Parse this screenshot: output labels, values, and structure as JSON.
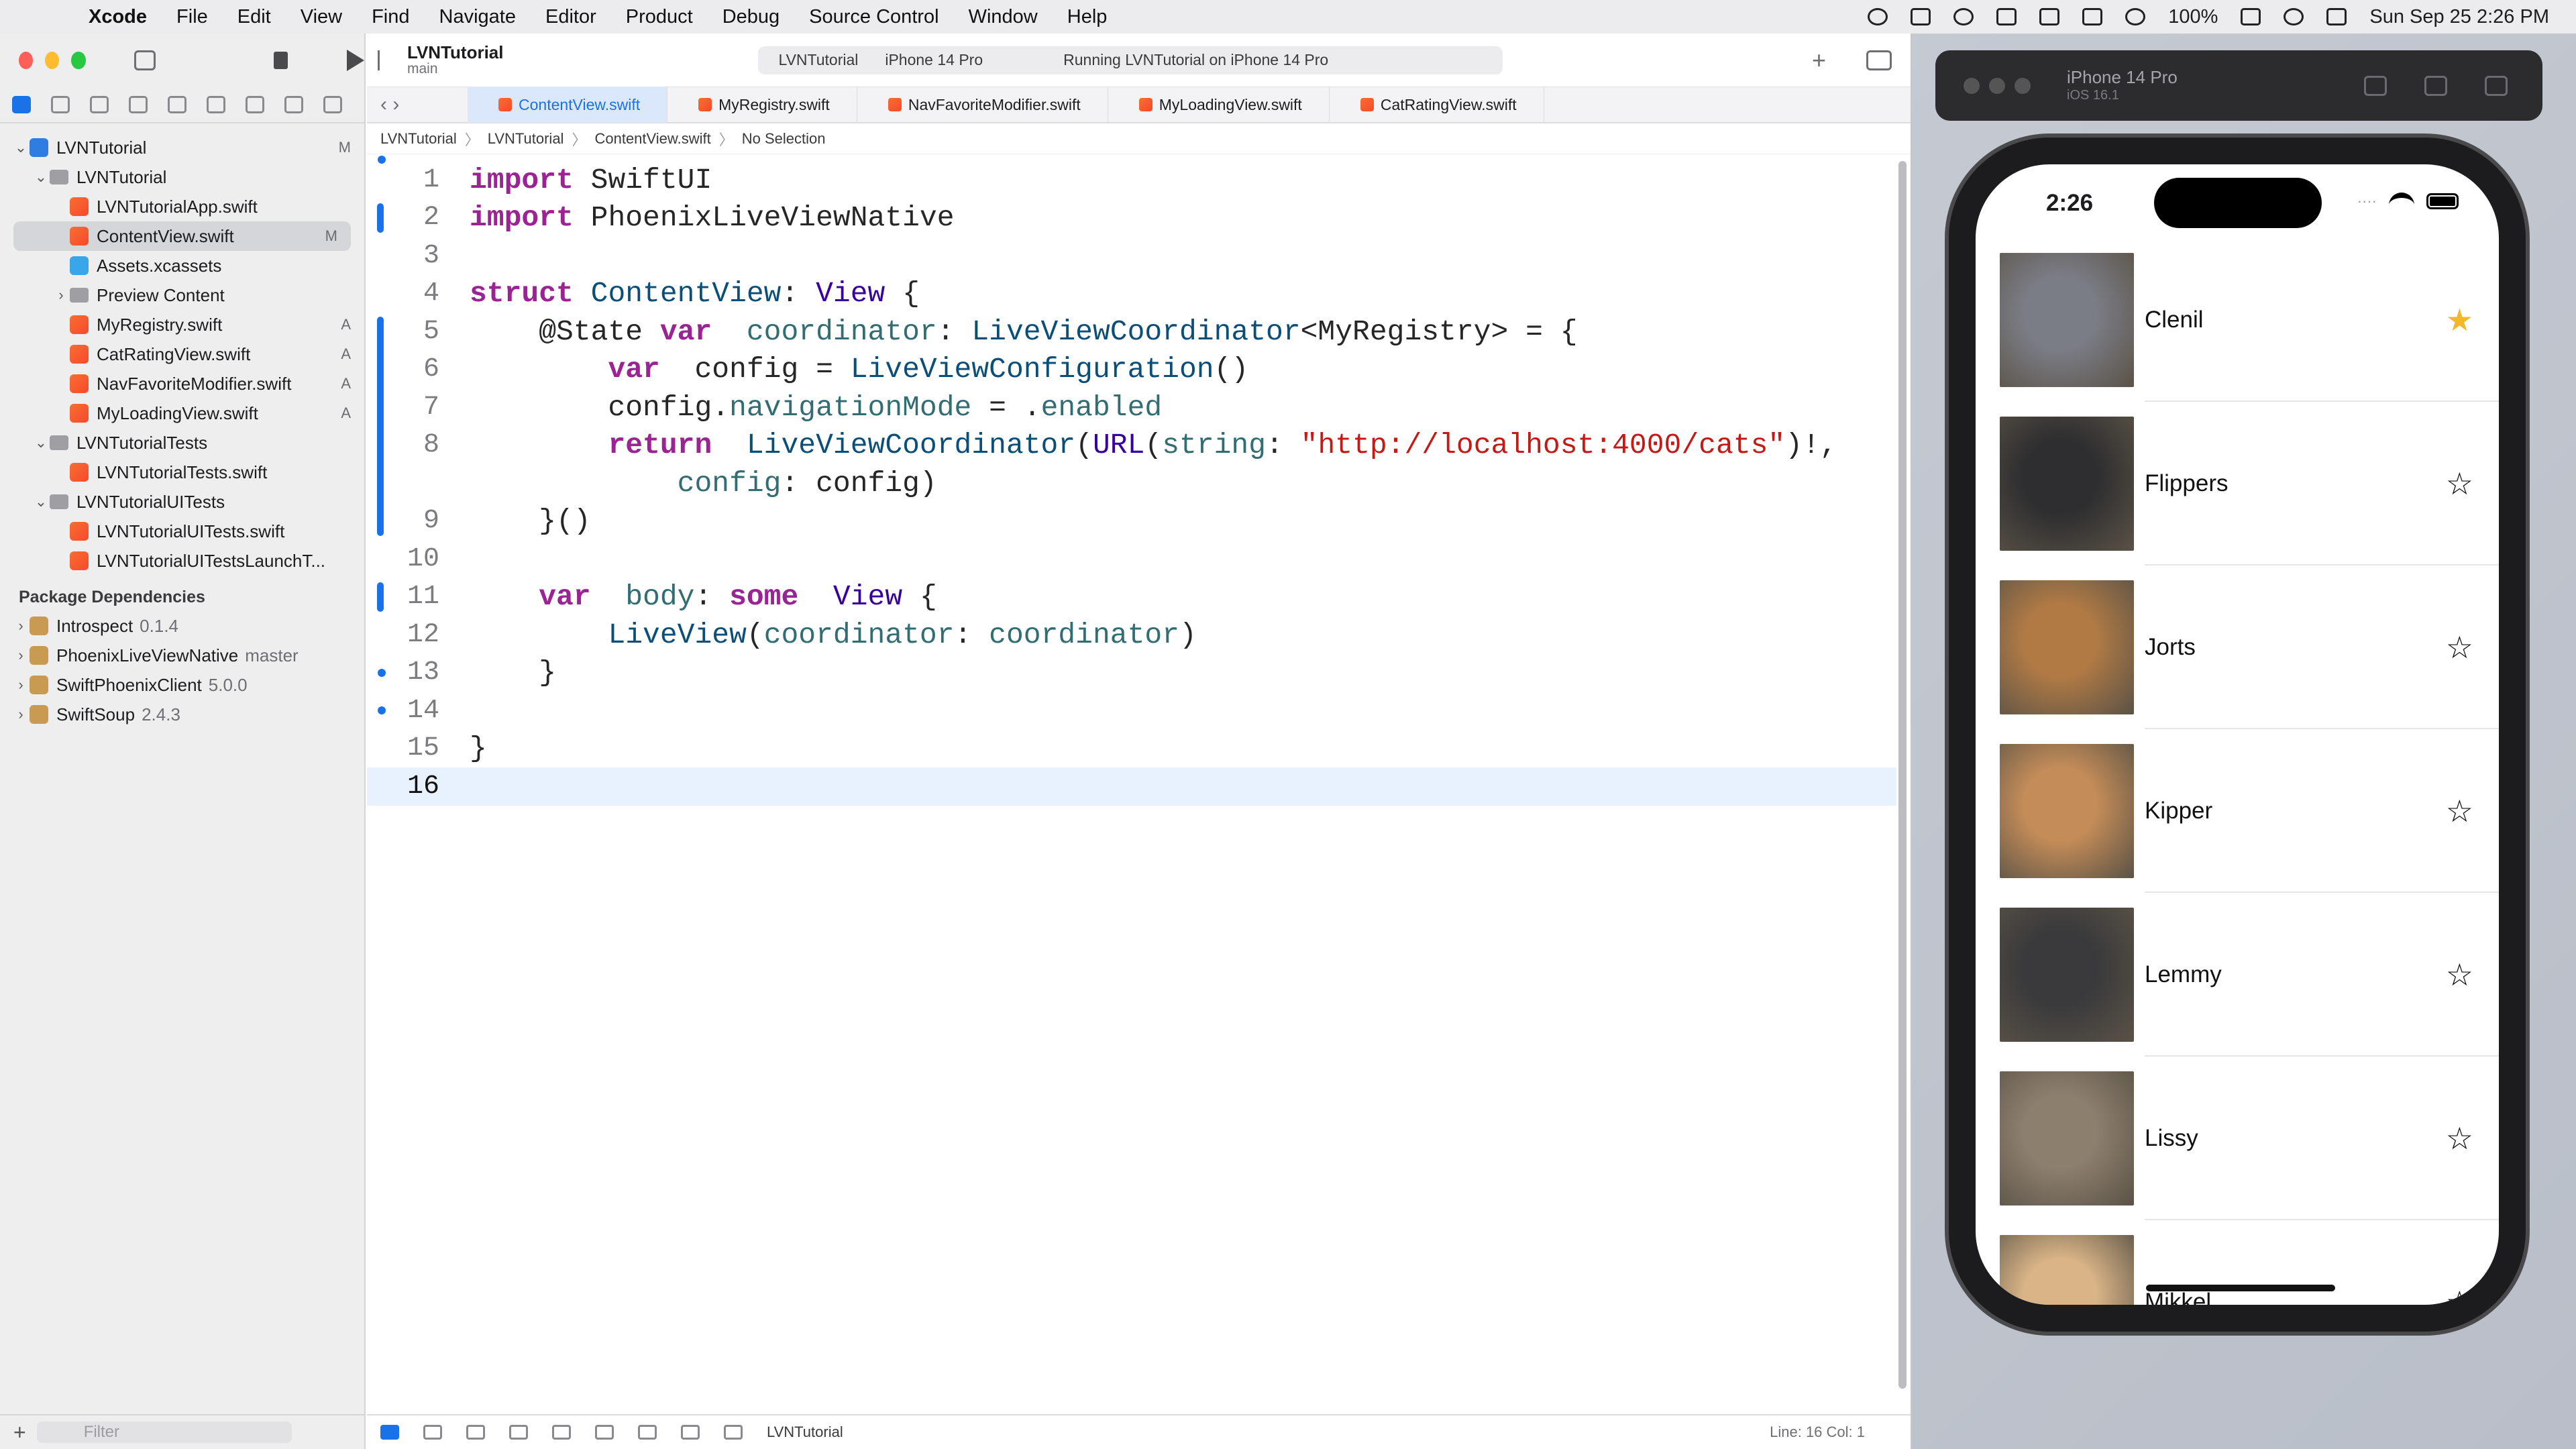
{
  "menubar": {
    "app": "Xcode",
    "items": [
      "File",
      "Edit",
      "View",
      "Find",
      "Navigate",
      "Editor",
      "Product",
      "Debug",
      "Source Control",
      "Window",
      "Help"
    ],
    "battery": "100%",
    "datetime": "Sun Sep 25  2:26 PM"
  },
  "navigator": {
    "tree": [
      {
        "label": "LVNTutorial",
        "indent": 0,
        "kind": "proj",
        "open": true,
        "badge": "M"
      },
      {
        "label": "LVNTutorial",
        "indent": 1,
        "kind": "folder",
        "open": true,
        "badge": ""
      },
      {
        "label": "LVNTutorialApp.swift",
        "indent": 2,
        "kind": "swift",
        "badge": ""
      },
      {
        "label": "ContentView.swift",
        "indent": 2,
        "kind": "swift",
        "badge": "M",
        "selected": true
      },
      {
        "label": "Assets.xcassets",
        "indent": 2,
        "kind": "assets",
        "badge": ""
      },
      {
        "label": "Preview Content",
        "indent": 2,
        "kind": "folder",
        "closed": true,
        "badge": ""
      },
      {
        "label": "MyRegistry.swift",
        "indent": 2,
        "kind": "swift",
        "badge": "A"
      },
      {
        "label": "CatRatingView.swift",
        "indent": 2,
        "kind": "swift",
        "badge": "A"
      },
      {
        "label": "NavFavoriteModifier.swift",
        "indent": 2,
        "kind": "swift",
        "badge": "A"
      },
      {
        "label": "MyLoadingView.swift",
        "indent": 2,
        "kind": "swift",
        "badge": "A"
      },
      {
        "label": "LVNTutorialTests",
        "indent": 1,
        "kind": "folder",
        "open": true,
        "badge": ""
      },
      {
        "label": "LVNTutorialTests.swift",
        "indent": 2,
        "kind": "swift",
        "badge": ""
      },
      {
        "label": "LVNTutorialUITests",
        "indent": 1,
        "kind": "folder",
        "open": true,
        "badge": ""
      },
      {
        "label": "LVNTutorialUITests.swift",
        "indent": 2,
        "kind": "swift",
        "badge": ""
      },
      {
        "label": "LVNTutorialUITestsLaunchT...",
        "indent": 2,
        "kind": "swift",
        "badge": ""
      }
    ],
    "packages_title": "Package Dependencies",
    "packages": [
      {
        "name": "Introspect",
        "version": "0.1.4"
      },
      {
        "name": "PhoenixLiveViewNative",
        "version": "master"
      },
      {
        "name": "SwiftPhoenixClient",
        "version": "5.0.0"
      },
      {
        "name": "SwiftSoup",
        "version": "2.4.3"
      }
    ],
    "filter_placeholder": "Filter"
  },
  "toolbar": {
    "project": "LVNTutorial",
    "branch": "main",
    "scheme": "LVNTutorial",
    "device": "iPhone 14 Pro",
    "status": "Running LVNTutorial on iPhone 14 Pro"
  },
  "tabs": [
    "ContentView.swift",
    "MyRegistry.swift",
    "NavFavoriteModifier.swift",
    "MyLoadingView.swift",
    "CatRatingView.swift"
  ],
  "breadcrumb": [
    "LVNTutorial",
    "LVNTutorial",
    "ContentView.swift",
    "No Selection"
  ],
  "code": [
    {
      "n": "1",
      "t": [
        [
          "kw",
          "import"
        ],
        [
          "",
          "SwiftUI"
        ]
      ]
    },
    {
      "n": "2",
      "t": [
        [
          "kw",
          "import"
        ],
        [
          "",
          "PhoenixLiveViewNative"
        ]
      ]
    },
    {
      "n": "3",
      "t": []
    },
    {
      "n": "4",
      "t": [
        [
          "kw",
          "struct"
        ],
        [
          "ty2",
          "ContentView"
        ],
        [
          "",
          ": "
        ],
        [
          "ty",
          "View"
        ],
        [
          "",
          " {"
        ]
      ]
    },
    {
      "n": "5",
      "t": [
        [
          "",
          "    @State "
        ],
        [
          "kw",
          "var"
        ],
        [
          "pr",
          " coordinator"
        ],
        [
          "",
          ": "
        ],
        [
          "ty2",
          "LiveViewCoordinator"
        ],
        [
          "",
          "<MyRegistry> = {"
        ]
      ]
    },
    {
      "n": "6",
      "t": [
        [
          "",
          "        "
        ],
        [
          "kw",
          "var"
        ],
        [
          "",
          " config = "
        ],
        [
          "ty2",
          "LiveViewConfiguration"
        ],
        [
          "",
          "()"
        ]
      ]
    },
    {
      "n": "7",
      "t": [
        [
          "",
          "        config."
        ],
        [
          "pr",
          "navigationMode"
        ],
        [
          "",
          " = ."
        ],
        [
          "pr",
          "enabled"
        ]
      ]
    },
    {
      "n": "8",
      "t": [
        [
          "",
          "        "
        ],
        [
          "kw",
          "return"
        ],
        [
          "ty2",
          " LiveViewCoordinator"
        ],
        [
          "",
          "("
        ],
        [
          "ty",
          "URL"
        ],
        [
          "",
          "("
        ],
        [
          "pr",
          "string"
        ],
        [
          "",
          ": "
        ],
        [
          "str",
          "\"http://localhost:4000/cats\""
        ],
        [
          "",
          ")!,"
        ]
      ]
    },
    {
      "n": "",
      "t": [
        [
          "",
          "            "
        ],
        [
          "pr",
          "config"
        ],
        [
          "",
          ": config)"
        ]
      ]
    },
    {
      "n": "9",
      "t": [
        [
          "",
          "    }()"
        ]
      ]
    },
    {
      "n": "10",
      "t": []
    },
    {
      "n": "11",
      "t": [
        [
          "",
          "    "
        ],
        [
          "kw",
          "var"
        ],
        [
          "pr",
          " body"
        ],
        [
          "",
          ": "
        ],
        [
          "kw",
          "some"
        ],
        [
          "ty",
          " View"
        ],
        [
          "",
          " {"
        ]
      ]
    },
    {
      "n": "12",
      "t": [
        [
          "",
          "        "
        ],
        [
          "ty2",
          "LiveView"
        ],
        [
          "",
          "("
        ],
        [
          "pr",
          "coordinator"
        ],
        [
          "",
          ": "
        ],
        [
          "pr",
          "coordinator"
        ],
        [
          "",
          ")"
        ]
      ]
    },
    {
      "n": "13",
      "t": [
        [
          "",
          "    }"
        ]
      ]
    },
    {
      "n": "14",
      "t": []
    },
    {
      "n": "15",
      "t": [
        [
          "",
          "}"
        ]
      ]
    },
    {
      "n": "16",
      "t": []
    }
  ],
  "bottombar": {
    "target": "LVNTutorial",
    "position": "Line: 16  Col: 1"
  },
  "simulator": {
    "device": "iPhone 14 Pro",
    "os": "iOS 16.1",
    "time": "2:26",
    "cats": [
      {
        "name": "Clenil",
        "fav": true,
        "color": "#7b7d86"
      },
      {
        "name": "Flippers",
        "fav": false,
        "color": "#2e2e30"
      },
      {
        "name": "Jorts",
        "fav": false,
        "color": "#b07a45"
      },
      {
        "name": "Kipper",
        "fav": false,
        "color": "#c48c58"
      },
      {
        "name": "Lemmy",
        "fav": false,
        "color": "#3a3a3c"
      },
      {
        "name": "Lissy",
        "fav": false,
        "color": "#8d7f6e"
      },
      {
        "name": "Mikkel",
        "fav": false,
        "color": "#d9b487"
      }
    ]
  }
}
